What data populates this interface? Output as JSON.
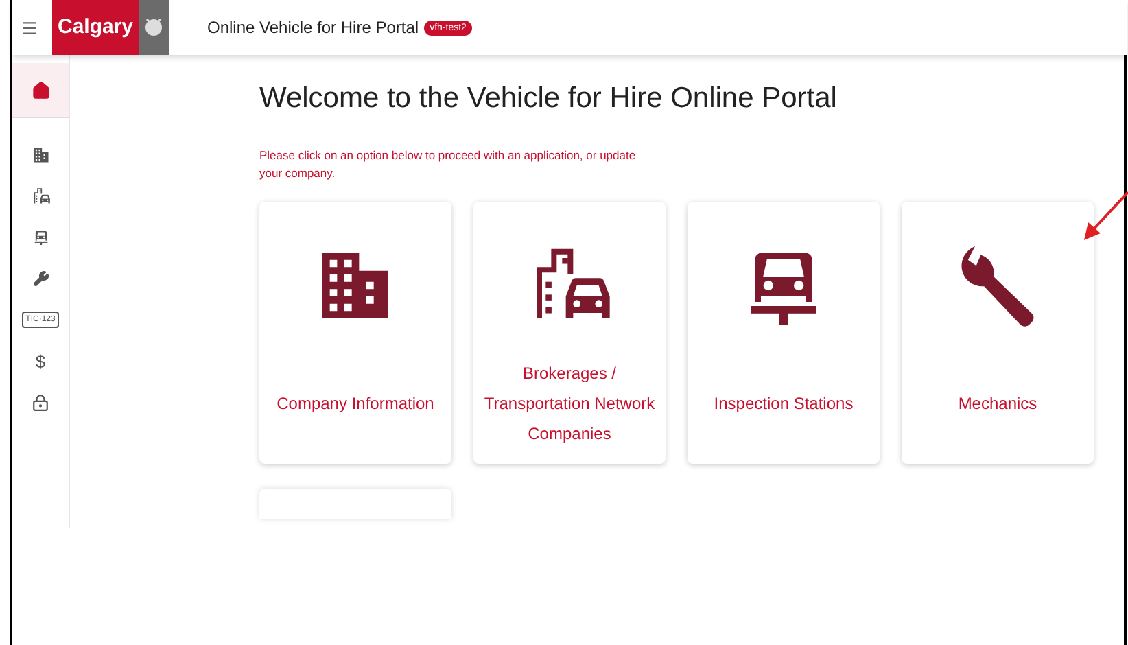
{
  "header": {
    "brand": "Calgary",
    "title": "Online Vehicle for Hire Portal",
    "badge": "vfh-test2"
  },
  "sidebar": {
    "items": [
      {
        "kind": "home",
        "selected": true
      },
      {
        "kind": "building",
        "selected": false
      },
      {
        "kind": "building-car",
        "selected": false
      },
      {
        "kind": "lift",
        "selected": false
      },
      {
        "kind": "wrench",
        "selected": false
      },
      {
        "kind": "plate",
        "selected": false,
        "text": "TIC·123"
      },
      {
        "kind": "dollar",
        "selected": false,
        "text": "$"
      },
      {
        "kind": "lock",
        "selected": false
      }
    ]
  },
  "main": {
    "heading": "Welcome to the Vehicle for Hire Online Portal",
    "intro": "Please click on an option below to proceed with an application, or update your company.",
    "cards": [
      {
        "kind": "building",
        "label": "Company Information"
      },
      {
        "kind": "building-car",
        "label": "Brokerages / Transportation Network Companies"
      },
      {
        "kind": "lift",
        "label": "Inspection Stations"
      },
      {
        "kind": "wrench",
        "label": "Mechanics"
      },
      {
        "kind": "partial"
      }
    ]
  }
}
